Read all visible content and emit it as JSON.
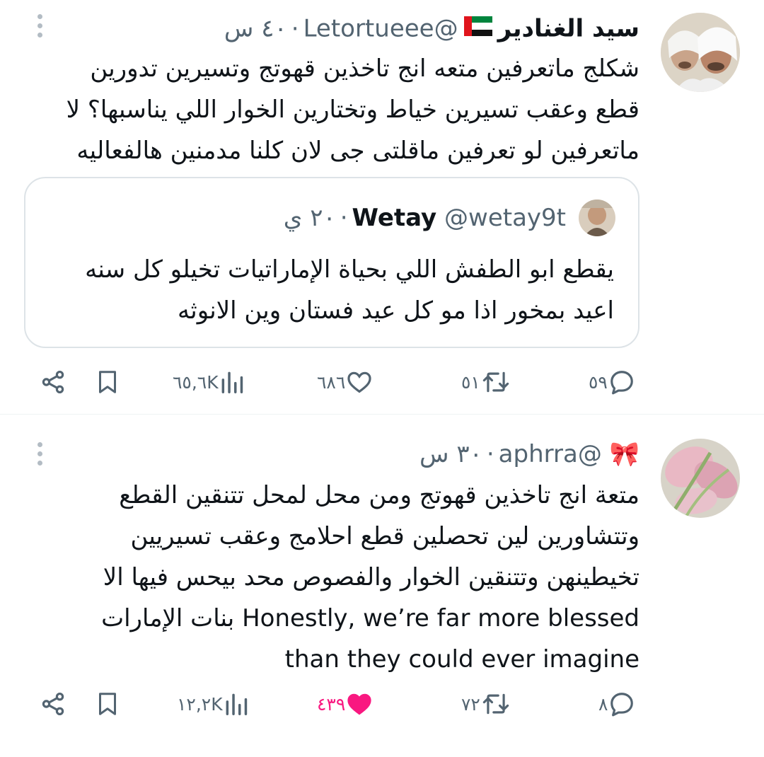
{
  "tweets": [
    {
      "author_name": "سيد الغنادير",
      "flag_icon": "uae-flag-icon",
      "handle": "@Letortueee",
      "time": "٤٠ س",
      "lines": [
        "شكلج ماتعرفين متعه انج تاخذين قهوتج وتسيرين تدورين",
        "قطع وعقب تسيرين خياط وتختارين الخوار اللي يناسبها؟ لا",
        "ماتعرفين لو تعرفين ماقلتى جى لان كلنا مدمنين هالفعاليه"
      ],
      "quoted": {
        "author_name": "Wetay",
        "handle": "@wetay9t",
        "time": "٢٠ ي",
        "lines": [
          "يقطع ابو الطفش اللي بحياة الإماراتيات تخيلو كل سنه",
          "اعيد بمخور اذا مو كل عيد فستان وين الانوثه"
        ]
      },
      "actions": {
        "replies": "٥٩",
        "retweets": "٥١",
        "likes": "٦٨٦",
        "views": "٦٥,٦K",
        "liked": false
      }
    },
    {
      "author_name": "",
      "name_symbol": "🎀",
      "handle": "@aphrra",
      "time": "٣٠ س",
      "lines": [
        "متعة انج تاخذين قهوتج ومن محل لمحل تتنقين القطع",
        "وتتشاورين لين تحصلين قطع احلامج وعقب تسيريين",
        "تخيطينهن وتتنقين الخوار والفصوص محد بيحس فيها الا",
        "بنات الإمارات",
        "Honestly, we’re far more blessed",
        "than they could ever imagine"
      ],
      "actions": {
        "replies": "٨",
        "retweets": "٧٢",
        "likes": "٤٣٩",
        "views": "١٢,٢K",
        "liked": true
      }
    }
  ],
  "colors": {
    "text": "#0f1419",
    "muted": "#536471",
    "like": "#f91880",
    "border": "#dde3e7"
  }
}
